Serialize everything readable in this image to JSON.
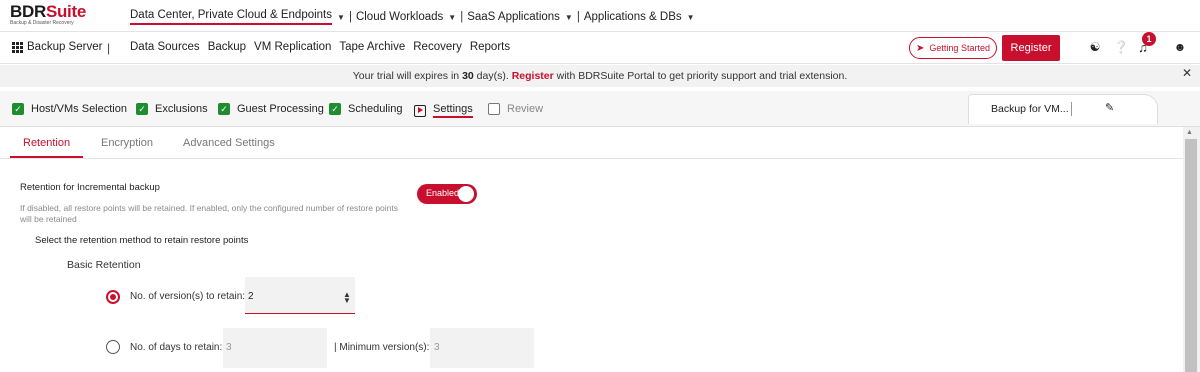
{
  "brand": {
    "name_main": "BDR",
    "name_accent": "Suite",
    "tagline": "Backup & Disaster Recovery"
  },
  "topnav": [
    {
      "label": "Data Center, Private Cloud & Endpoints"
    },
    {
      "label": "Cloud Workloads"
    },
    {
      "label": "SaaS Applications"
    },
    {
      "label": "Applications & DBs"
    }
  ],
  "navbar": {
    "server": "Backup Server",
    "divider": "|",
    "menu": [
      "Data Sources",
      "Backup",
      "VM Replication",
      "Tape Archive",
      "Recovery",
      "Reports"
    ],
    "getting_started": "Getting Started",
    "register": "Register",
    "notification_count": "1"
  },
  "banner": {
    "prefix": "Your trial will expires in ",
    "days": "30",
    "mid": " day(s). ",
    "register": "Register",
    "suffix": " with BDRSuite Portal to get priority support and trial extension."
  },
  "steps": [
    {
      "label": "Host/VMs Selection",
      "state": "done"
    },
    {
      "label": "Exclusions",
      "state": "done"
    },
    {
      "label": "Guest Processing",
      "state": "done"
    },
    {
      "label": "Scheduling",
      "state": "done"
    },
    {
      "label": "Settings",
      "state": "active"
    },
    {
      "label": "Review",
      "state": "pending"
    }
  ],
  "job_name": "Backup for VM...",
  "subtabs": [
    "Retention",
    "Encryption",
    "Advanced Settings"
  ],
  "retention": {
    "title": "Retention for Incremental backup",
    "description": "If disabled, all restore points will be retained. If enabled, only the configured number of restore points will be retained",
    "toggle_label": "Enabled",
    "method_title": "Select the retention method to retain restore points",
    "basic_title": "Basic Retention",
    "versions_label": "No. of version(s) to retain:",
    "versions_value": "2",
    "days_label": "No. of days to retain:",
    "days_value": "3",
    "min_label": "| Minimum version(s):",
    "min_value": "3"
  },
  "colors": {
    "accent": "#c8102e",
    "done_green": "#1f8c2f"
  },
  "icons": [
    "grid-icon",
    "rocket-icon",
    "users-icon",
    "help-icon",
    "bell-icon",
    "user-icon",
    "close-icon",
    "edit-icon",
    "chevron-down-icon",
    "check-icon",
    "play-icon",
    "spinner-icon"
  ]
}
